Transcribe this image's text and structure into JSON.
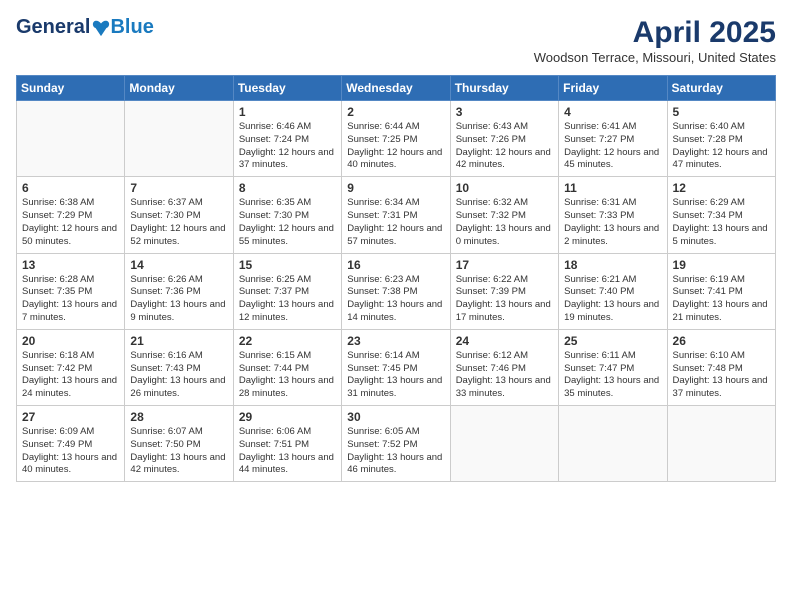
{
  "header": {
    "logo_general": "General",
    "logo_blue": "Blue",
    "month_title": "April 2025",
    "location": "Woodson Terrace, Missouri, United States"
  },
  "days_of_week": [
    "Sunday",
    "Monday",
    "Tuesday",
    "Wednesday",
    "Thursday",
    "Friday",
    "Saturday"
  ],
  "weeks": [
    [
      {
        "day": "",
        "info": ""
      },
      {
        "day": "",
        "info": ""
      },
      {
        "day": "1",
        "info": "Sunrise: 6:46 AM\nSunset: 7:24 PM\nDaylight: 12 hours and 37 minutes."
      },
      {
        "day": "2",
        "info": "Sunrise: 6:44 AM\nSunset: 7:25 PM\nDaylight: 12 hours and 40 minutes."
      },
      {
        "day": "3",
        "info": "Sunrise: 6:43 AM\nSunset: 7:26 PM\nDaylight: 12 hours and 42 minutes."
      },
      {
        "day": "4",
        "info": "Sunrise: 6:41 AM\nSunset: 7:27 PM\nDaylight: 12 hours and 45 minutes."
      },
      {
        "day": "5",
        "info": "Sunrise: 6:40 AM\nSunset: 7:28 PM\nDaylight: 12 hours and 47 minutes."
      }
    ],
    [
      {
        "day": "6",
        "info": "Sunrise: 6:38 AM\nSunset: 7:29 PM\nDaylight: 12 hours and 50 minutes."
      },
      {
        "day": "7",
        "info": "Sunrise: 6:37 AM\nSunset: 7:30 PM\nDaylight: 12 hours and 52 minutes."
      },
      {
        "day": "8",
        "info": "Sunrise: 6:35 AM\nSunset: 7:30 PM\nDaylight: 12 hours and 55 minutes."
      },
      {
        "day": "9",
        "info": "Sunrise: 6:34 AM\nSunset: 7:31 PM\nDaylight: 12 hours and 57 minutes."
      },
      {
        "day": "10",
        "info": "Sunrise: 6:32 AM\nSunset: 7:32 PM\nDaylight: 13 hours and 0 minutes."
      },
      {
        "day": "11",
        "info": "Sunrise: 6:31 AM\nSunset: 7:33 PM\nDaylight: 13 hours and 2 minutes."
      },
      {
        "day": "12",
        "info": "Sunrise: 6:29 AM\nSunset: 7:34 PM\nDaylight: 13 hours and 5 minutes."
      }
    ],
    [
      {
        "day": "13",
        "info": "Sunrise: 6:28 AM\nSunset: 7:35 PM\nDaylight: 13 hours and 7 minutes."
      },
      {
        "day": "14",
        "info": "Sunrise: 6:26 AM\nSunset: 7:36 PM\nDaylight: 13 hours and 9 minutes."
      },
      {
        "day": "15",
        "info": "Sunrise: 6:25 AM\nSunset: 7:37 PM\nDaylight: 13 hours and 12 minutes."
      },
      {
        "day": "16",
        "info": "Sunrise: 6:23 AM\nSunset: 7:38 PM\nDaylight: 13 hours and 14 minutes."
      },
      {
        "day": "17",
        "info": "Sunrise: 6:22 AM\nSunset: 7:39 PM\nDaylight: 13 hours and 17 minutes."
      },
      {
        "day": "18",
        "info": "Sunrise: 6:21 AM\nSunset: 7:40 PM\nDaylight: 13 hours and 19 minutes."
      },
      {
        "day": "19",
        "info": "Sunrise: 6:19 AM\nSunset: 7:41 PM\nDaylight: 13 hours and 21 minutes."
      }
    ],
    [
      {
        "day": "20",
        "info": "Sunrise: 6:18 AM\nSunset: 7:42 PM\nDaylight: 13 hours and 24 minutes."
      },
      {
        "day": "21",
        "info": "Sunrise: 6:16 AM\nSunset: 7:43 PM\nDaylight: 13 hours and 26 minutes."
      },
      {
        "day": "22",
        "info": "Sunrise: 6:15 AM\nSunset: 7:44 PM\nDaylight: 13 hours and 28 minutes."
      },
      {
        "day": "23",
        "info": "Sunrise: 6:14 AM\nSunset: 7:45 PM\nDaylight: 13 hours and 31 minutes."
      },
      {
        "day": "24",
        "info": "Sunrise: 6:12 AM\nSunset: 7:46 PM\nDaylight: 13 hours and 33 minutes."
      },
      {
        "day": "25",
        "info": "Sunrise: 6:11 AM\nSunset: 7:47 PM\nDaylight: 13 hours and 35 minutes."
      },
      {
        "day": "26",
        "info": "Sunrise: 6:10 AM\nSunset: 7:48 PM\nDaylight: 13 hours and 37 minutes."
      }
    ],
    [
      {
        "day": "27",
        "info": "Sunrise: 6:09 AM\nSunset: 7:49 PM\nDaylight: 13 hours and 40 minutes."
      },
      {
        "day": "28",
        "info": "Sunrise: 6:07 AM\nSunset: 7:50 PM\nDaylight: 13 hours and 42 minutes."
      },
      {
        "day": "29",
        "info": "Sunrise: 6:06 AM\nSunset: 7:51 PM\nDaylight: 13 hours and 44 minutes."
      },
      {
        "day": "30",
        "info": "Sunrise: 6:05 AM\nSunset: 7:52 PM\nDaylight: 13 hours and 46 minutes."
      },
      {
        "day": "",
        "info": ""
      },
      {
        "day": "",
        "info": ""
      },
      {
        "day": "",
        "info": ""
      }
    ]
  ]
}
